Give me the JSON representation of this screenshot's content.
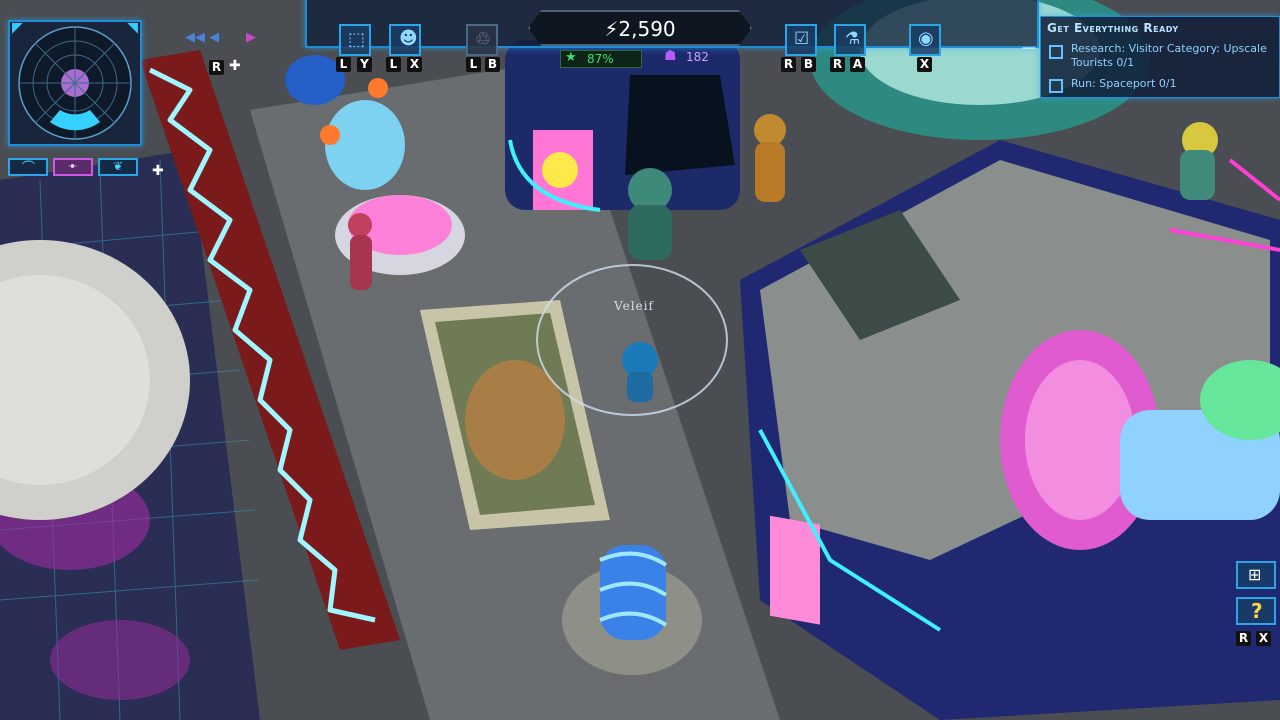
{
  "resources": {
    "power_icon": "lightning-icon",
    "power": "⚡2,590",
    "happiness": "87%",
    "visitors": "182"
  },
  "toolbar": {
    "left_tools": [
      {
        "icon": "build-cube-icon",
        "keys": [
          "L",
          "Y"
        ]
      },
      {
        "icon": "alien-icon",
        "keys": [
          "L",
          "X"
        ]
      },
      {
        "icon": "recycle-icon",
        "keys": [
          "L",
          "B"
        ]
      }
    ],
    "right_tools": [
      {
        "icon": "research-checklist-icon",
        "keys": [
          "R",
          "B"
        ]
      },
      {
        "icon": "flask-icon",
        "keys": [
          "R",
          "A"
        ]
      },
      {
        "icon": "settings-ring-icon",
        "keys": [
          "X"
        ]
      }
    ]
  },
  "minimap": {
    "toggle_key": "R"
  },
  "minimap_modes": [
    "dashboard-icon",
    "crowd-icon",
    "nature-icon"
  ],
  "quest": {
    "title": "Get Everything Ready",
    "items": [
      {
        "label": "Research: Visitor Category: Upscale Tourists",
        "progress": "0/1",
        "done": false
      },
      {
        "label": "Run: Spaceport",
        "progress": "0/1",
        "done": false
      }
    ]
  },
  "player": {
    "name": "Veleif"
  },
  "side_buttons": {
    "help_keys": [
      "R",
      "X"
    ]
  },
  "colors": {
    "hud_blue": "#1e8fd6",
    "neon_cyan": "#3ff0ff",
    "neon_magenta": "#ff3fd6",
    "happiness_green": "#37e06a",
    "visitor_purple": "#b45cff"
  }
}
